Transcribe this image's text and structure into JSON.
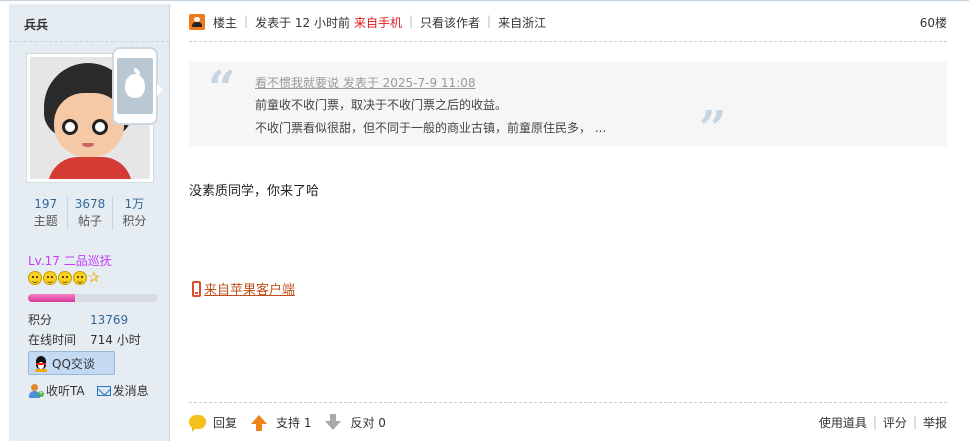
{
  "user": {
    "name": "兵兵",
    "stats": [
      {
        "value": "197",
        "label": "主题"
      },
      {
        "value": "3678",
        "label": "帖子"
      },
      {
        "value": "1万",
        "label": "积分"
      }
    ],
    "level": "Lv.17 二品巡抚",
    "level_progress": 0.36,
    "info": [
      {
        "key": "积分",
        "value": "13769"
      },
      {
        "key": "在线时间",
        "value": "714 小时"
      }
    ],
    "qq_label": "QQ交谈",
    "follow_label": "收听TA",
    "message_label": "发消息"
  },
  "post": {
    "op_label": "楼主",
    "posted": "发表于 12 小时前",
    "source": "来自手机",
    "only_author": "只看该作者",
    "location": "来自浙江",
    "floor": "60楼",
    "quote": {
      "author": "看不惯我就要说 发表于 2025-7-9 11:08",
      "line1": "前童收不收门票，取决于不收门票之后的收益。",
      "line2": "不收门票看似很甜，但不同于一般的商业古镇，前童原住民多，  ..."
    },
    "body": "没素质同学，你来了哈",
    "client_link": "来自苹果客户端"
  },
  "actions": {
    "reply": "回复",
    "support": "支持 1",
    "oppose": "反对 0",
    "use_tool": "使用道具",
    "rate": "评分",
    "report": "举报"
  },
  "colors": {
    "side_bg": "#e5edf2",
    "link_blue": "#336699",
    "source_red": "#e31b1b",
    "level_purple": "#c43bff",
    "client_link": "#c0501a"
  }
}
